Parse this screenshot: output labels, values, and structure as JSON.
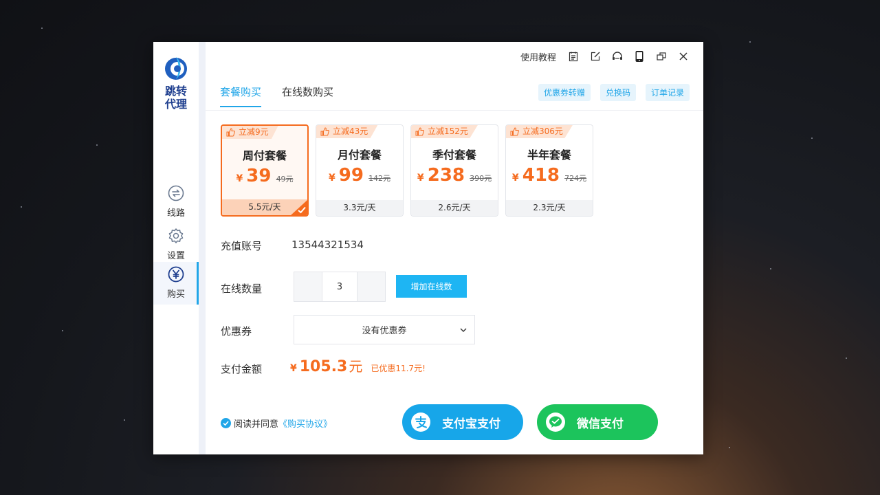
{
  "app": {
    "logo_text_line1": "跳转",
    "logo_text_line2": "代理"
  },
  "sidebar": {
    "items": [
      {
        "label": "线路",
        "icon": "route-icon"
      },
      {
        "label": "设置",
        "icon": "gear-icon"
      },
      {
        "label": "购买",
        "icon": "yen-icon",
        "active": true
      }
    ]
  },
  "titlebar": {
    "tutorial": "使用教程"
  },
  "tabs": [
    {
      "label": "套餐购买",
      "active": true
    },
    {
      "label": "在线数购买",
      "active": false
    }
  ],
  "top_buttons": {
    "coupon_transfer": "优惠券转赠",
    "redeem_code": "兑换码",
    "order_history": "订单记录"
  },
  "plans": [
    {
      "badge": "立减9元",
      "name": "周付套餐",
      "currency": "¥",
      "price": "39",
      "original": "49元",
      "daily": "5.5元/天",
      "selected": true
    },
    {
      "badge": "立减43元",
      "name": "月付套餐",
      "currency": "¥",
      "price": "99",
      "original": "142元",
      "daily": "3.3元/天",
      "selected": false
    },
    {
      "badge": "立减152元",
      "name": "季付套餐",
      "currency": "¥",
      "price": "238",
      "original": "390元",
      "daily": "2.6元/天",
      "selected": false
    },
    {
      "badge": "立减306元",
      "name": "半年套餐",
      "currency": "¥",
      "price": "418",
      "original": "724元",
      "daily": "2.3元/天",
      "selected": false
    }
  ],
  "form": {
    "account_label": "充值账号",
    "account_value": "13544321534",
    "online_label": "在线数量",
    "online_value": "3",
    "add_online": "增加在线数",
    "coupon_label": "优惠券",
    "coupon_value": "没有优惠券",
    "pay_label": "支付金额",
    "pay_currency": "¥",
    "pay_amount": "105.3",
    "pay_unit": "元",
    "pay_saved": "已优惠11.7元!"
  },
  "agreement": {
    "prefix": "阅读并同意",
    "link": "《购买协议》",
    "checked": true
  },
  "payment": {
    "alipay": "支付宝支付",
    "wechat": "微信支付"
  },
  "colors": {
    "accent": "#21a6e8",
    "orange": "#f56b1e",
    "alipay": "#17a6e9",
    "wechat": "#1cc45c"
  }
}
